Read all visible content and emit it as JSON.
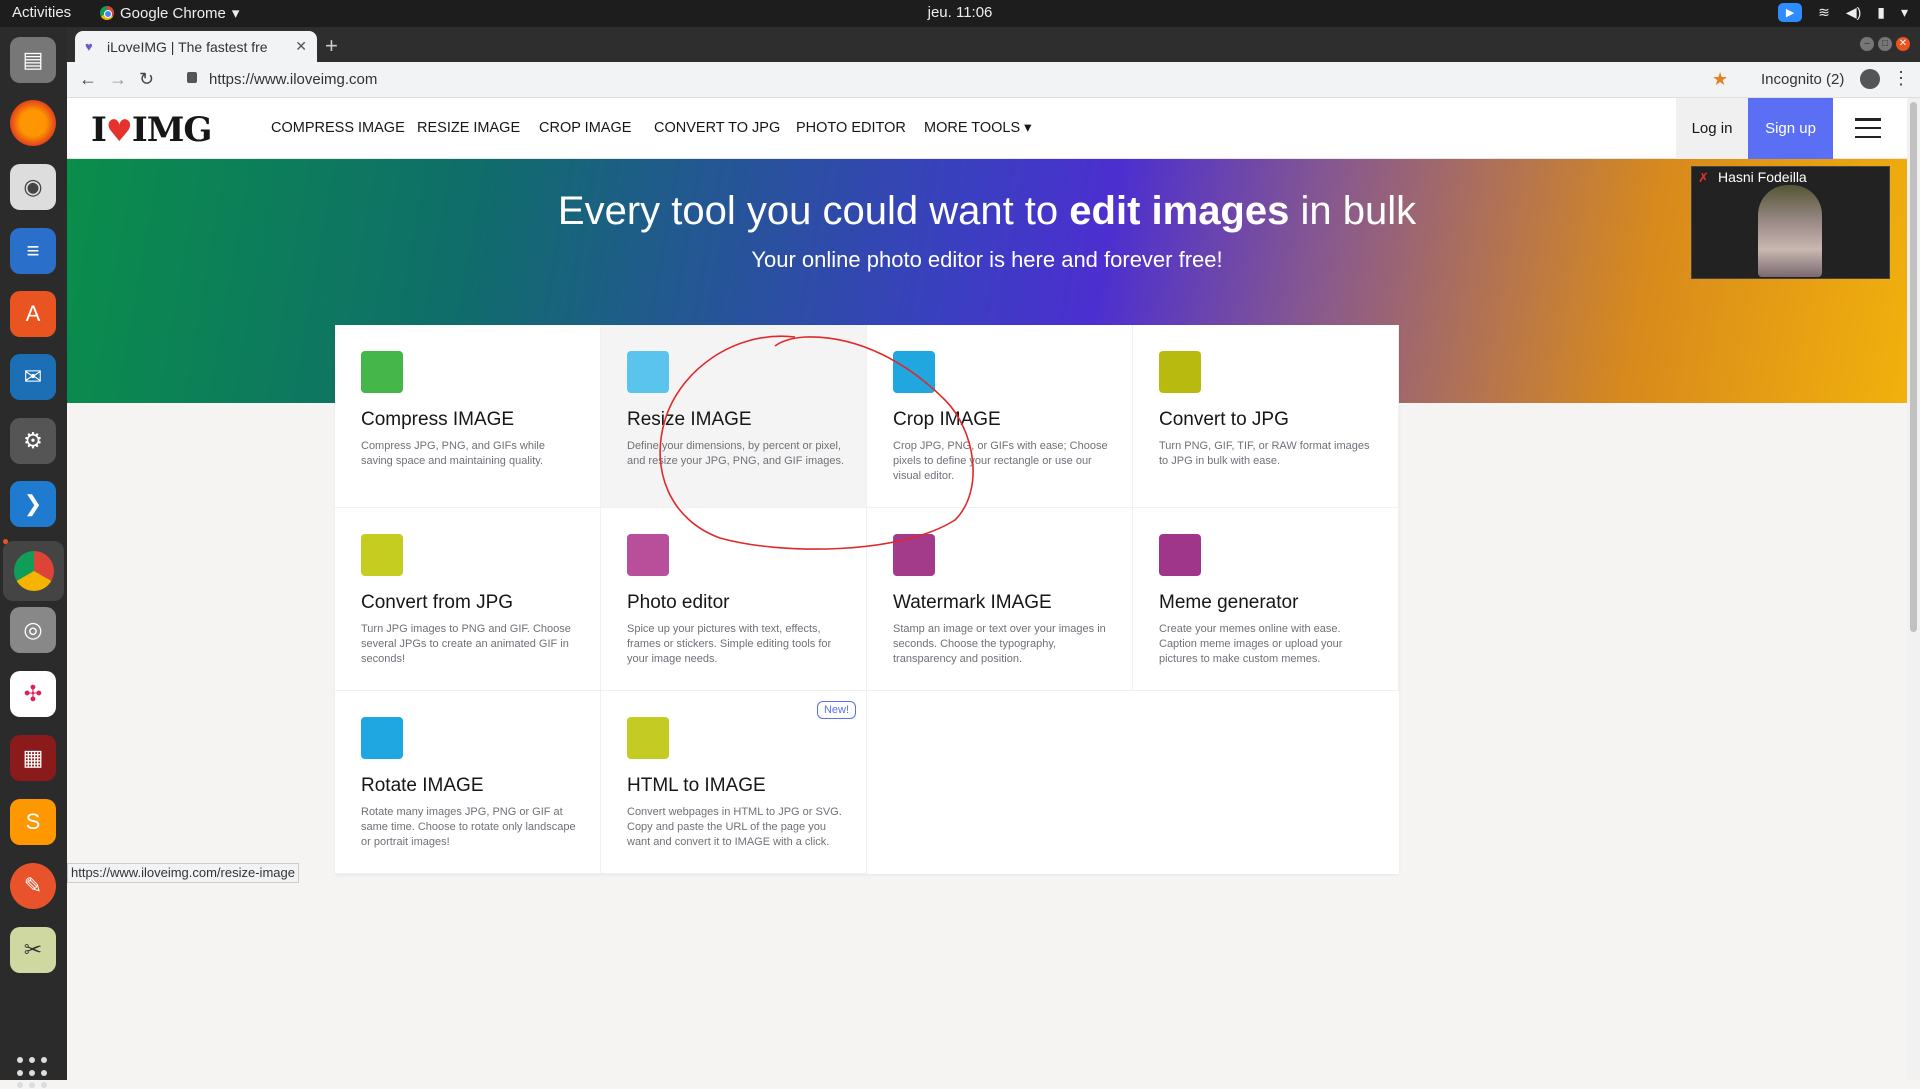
{
  "os": {
    "activities": "Activities",
    "app_menu": "Google Chrome",
    "clock": "jeu. 11:06"
  },
  "browser": {
    "tab_title": "iLoveIMG | The fastest fre",
    "url": "https://www.iloveimg.com",
    "incognito_label": "Incognito (2)",
    "status_url": "https://www.iloveimg.com/resize-image"
  },
  "site": {
    "logo": {
      "prefix": "I",
      "suffix": "IMG"
    },
    "nav": [
      "COMPRESS IMAGE",
      "RESIZE IMAGE",
      "CROP IMAGE",
      "CONVERT TO JPG",
      "PHOTO EDITOR",
      "MORE TOOLS ▾"
    ],
    "login": "Log in",
    "signup": "Sign up",
    "hero": {
      "title_start": "Every tool you could want to ",
      "title_bold": "edit images",
      "title_end": " in bulk",
      "subtitle": "Your online photo editor is here and forever free!"
    },
    "video_name": "Hasni Fodeilla",
    "tools": [
      {
        "title": "Compress IMAGE",
        "desc": "Compress JPG, PNG, and GIFs while saving space and maintaining quality.",
        "color": "#45b649",
        "icon": "compress-icon"
      },
      {
        "title": "Resize IMAGE",
        "desc": "Define your dimensions, by percent or pixel, and resize your JPG, PNG, and GIF images.",
        "color": "#5bc4ec",
        "icon": "resize-icon"
      },
      {
        "title": "Crop IMAGE",
        "desc": "Crop JPG, PNG, or GIFs with ease; Choose pixels to define your rectangle or use our visual editor.",
        "color": "#21a7e0",
        "icon": "scissors-icon"
      },
      {
        "title": "Convert to JPG",
        "desc": "Turn PNG, GIF, TIF, or RAW format images to JPG in bulk with ease.",
        "color": "#b8ba10",
        "icon": "jpg-icon"
      },
      {
        "title": "Convert from JPG",
        "desc": "Turn JPG images to PNG and GIF. Choose several JPGs to create an animated GIF in seconds!",
        "color": "#c5cd21",
        "icon": "jpg-out-icon"
      },
      {
        "title": "Photo editor",
        "desc": "Spice up your pictures with text, effects, frames or stickers. Simple editing tools for your image needs.",
        "color": "#b94f9b",
        "icon": "pencil-icon"
      },
      {
        "title": "Watermark IMAGE",
        "desc": "Stamp an image or text over your images in seconds. Choose the typography, transparency and position.",
        "color": "#a33b8a",
        "icon": "stamp-icon"
      },
      {
        "title": "Meme generator",
        "desc": "Create your memes online with ease. Caption meme images or upload your pictures to make custom memes.",
        "color": "#a0368a",
        "icon": "laugh-icon"
      },
      {
        "title": "Rotate IMAGE",
        "desc": "Rotate many images JPG, PNG or GIF at same time. Choose to rotate only landscape or portrait images!",
        "color": "#1ea7e0",
        "icon": "rotate-icon"
      },
      {
        "title": "HTML to IMAGE",
        "desc": "Convert webpages in HTML to JPG or SVG. Copy and paste the URL of the page you want and convert it to IMAGE with a click.",
        "color": "#c4cb22",
        "icon": "html-icon",
        "badge": "New!"
      }
    ]
  }
}
